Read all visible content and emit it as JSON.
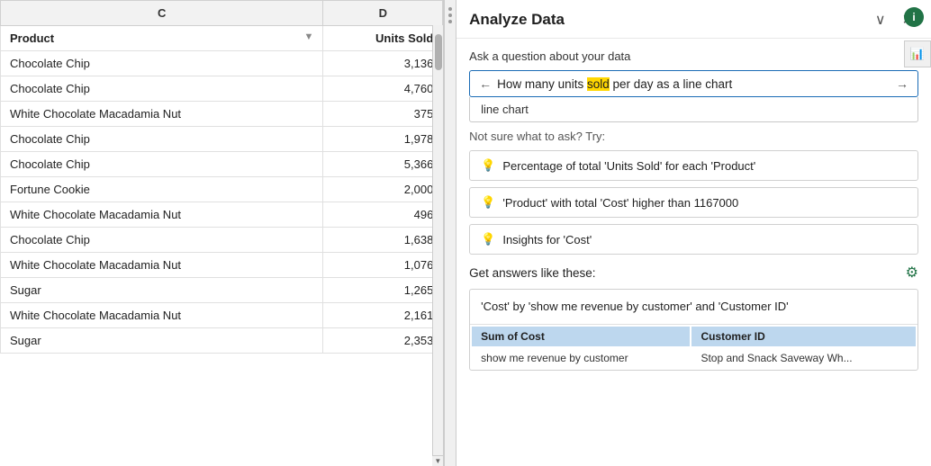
{
  "spreadsheet": {
    "col_c_header": "C",
    "col_d_header": "D",
    "product_header": "Product",
    "units_header": "Units Sold",
    "rows": [
      {
        "product": "Chocolate Chip",
        "units": "3,136"
      },
      {
        "product": "Chocolate Chip",
        "units": "4,760"
      },
      {
        "product": "White Chocolate Macadamia Nut",
        "units": "375"
      },
      {
        "product": "Chocolate Chip",
        "units": "1,978"
      },
      {
        "product": "Chocolate Chip",
        "units": "5,366"
      },
      {
        "product": "Fortune Cookie",
        "units": "2,000"
      },
      {
        "product": "White Chocolate Macadamia Nut",
        "units": "496"
      },
      {
        "product": "Chocolate Chip",
        "units": "1,638"
      },
      {
        "product": "White Chocolate Macadamia Nut",
        "units": "1,076"
      },
      {
        "product": "Sugar",
        "units": "1,265"
      },
      {
        "product": "White Chocolate Macadamia Nut",
        "units": "2,161"
      },
      {
        "product": "Sugar",
        "units": "2,353"
      }
    ]
  },
  "panel": {
    "title": "Analyze Data",
    "ask_label": "Ask a question about your data",
    "search_query": "How many units sold per day as a line chart",
    "cursor_word": "sold",
    "autocomplete_suggestion": "line chart",
    "not_sure_label": "Not sure what to ask? Try:",
    "suggestions": [
      "Percentage of total 'Units Sold' for each 'Product'",
      "'Product' with total 'Cost' higher than 1167000",
      "Insights for 'Cost'"
    ],
    "get_answers_label": "Get answers like these:",
    "answer_card": {
      "text": "'Cost' by 'show me revenue by customer' and 'Customer ID'",
      "table_headers": [
        "Sum of Cost",
        "Customer ID"
      ],
      "table_row": [
        "show me revenue by customer",
        "Stop and Snack",
        "Saveway",
        "Wh..."
      ]
    },
    "minimize_icon": "∨",
    "close_icon": "✕",
    "info_icon": "i"
  }
}
